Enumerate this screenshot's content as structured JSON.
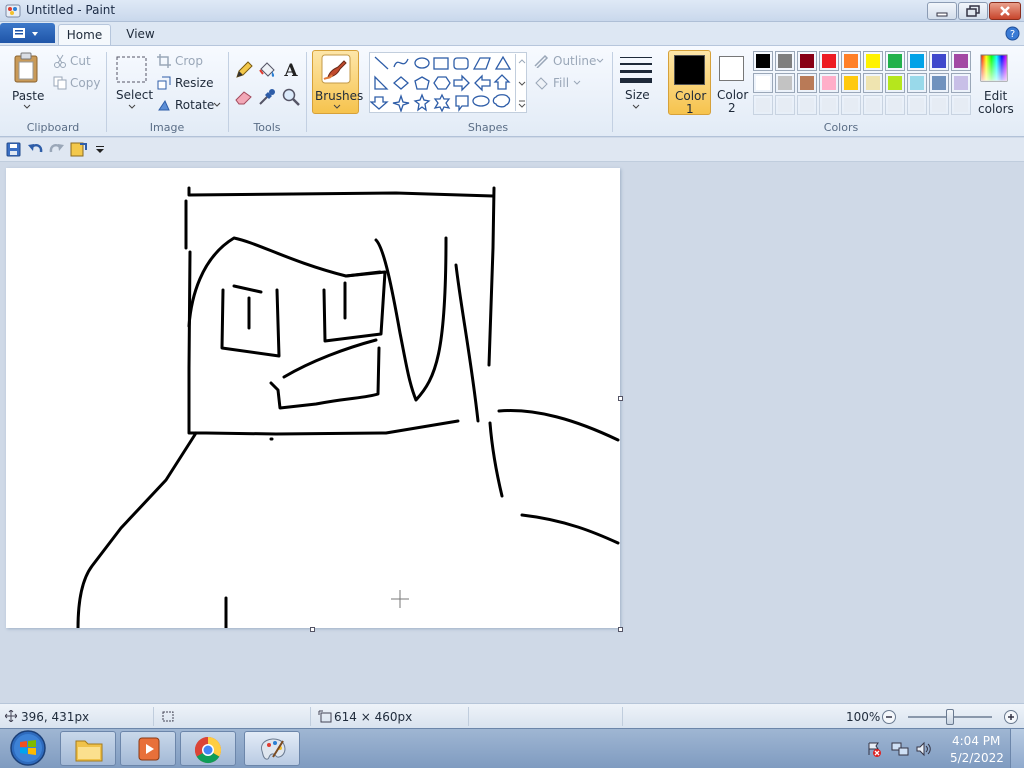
{
  "window": {
    "title": "Untitled - Paint"
  },
  "tabs": [
    {
      "label": "Home"
    },
    {
      "label": "View"
    }
  ],
  "ribbon": {
    "clipboard": {
      "paste": "Paste",
      "cut": "Cut",
      "copy": "Copy",
      "group": "Clipboard"
    },
    "image": {
      "select": "Select",
      "crop": "Crop",
      "resize": "Resize",
      "rotate": "Rotate",
      "group": "Image"
    },
    "tools": {
      "group": "Tools"
    },
    "brushes": {
      "label": "Brushes"
    },
    "shapes": {
      "outline": "Outline",
      "fill": "Fill",
      "group": "Shapes"
    },
    "size": {
      "label": "Size"
    },
    "colors": {
      "color1": "Color",
      "color1_num": "1",
      "color2": "Color",
      "color2_num": "2",
      "edit": "Edit",
      "edit2": "colors",
      "group": "Colors",
      "color1_value": "#000000",
      "color2_value": "#ffffff",
      "palette_row1": [
        "#000000",
        "#7f7f7f",
        "#880015",
        "#ed1c24",
        "#ff7f27",
        "#fff200",
        "#22b14c",
        "#00a2e8",
        "#3f48cc",
        "#a349a4"
      ],
      "palette_row2": [
        "#ffffff",
        "#c3c3c3",
        "#b97a57",
        "#ffaec9",
        "#ffc90e",
        "#efe4b0",
        "#b5e61d",
        "#99d9ea",
        "#7092be",
        "#c8bfe7"
      ]
    }
  },
  "status": {
    "cursor": "396, 431px",
    "canvas_size": "614 × 460px",
    "zoom": "100%",
    "zoom_value": 100
  },
  "taskbar": {
    "time": "4:04 PM",
    "date": "5/2/2022"
  }
}
